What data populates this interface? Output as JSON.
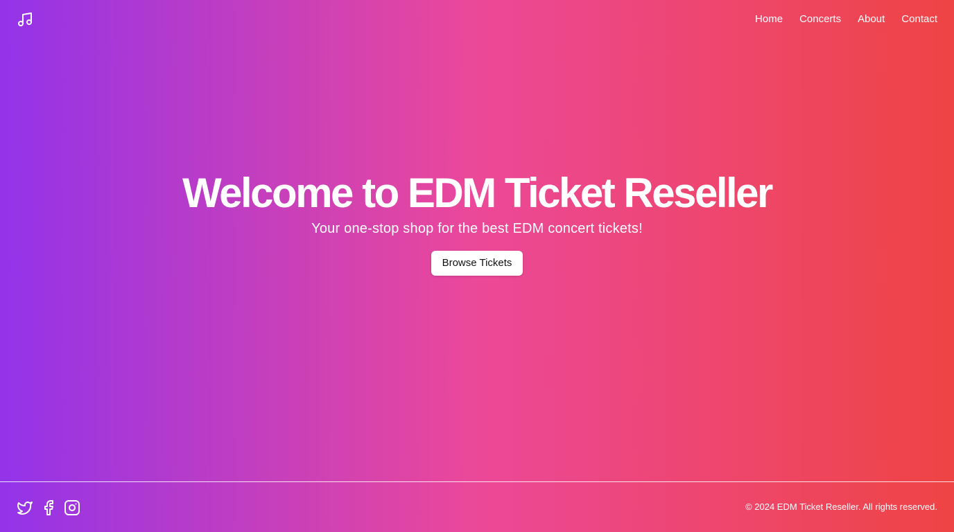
{
  "header": {
    "logo_icon": "music-note-icon",
    "nav": [
      {
        "label": "Home"
      },
      {
        "label": "Concerts"
      },
      {
        "label": "About"
      },
      {
        "label": "Contact"
      }
    ]
  },
  "hero": {
    "title": "Welcome to EDM Ticket Reseller",
    "subtitle": "Your one-stop shop for the best EDM concert tickets!",
    "cta_label": "Browse Tickets"
  },
  "footer": {
    "socials": [
      "twitter-icon",
      "facebook-icon",
      "instagram-icon"
    ],
    "copyright": "© 2024 EDM Ticket Reseller. All rights reserved."
  },
  "colors": {
    "gradient_start": "#9333ea",
    "gradient_mid": "#ec4899",
    "gradient_end": "#ef4444",
    "text": "#ffffff",
    "button_bg": "#ffffff",
    "button_text": "#111111"
  }
}
